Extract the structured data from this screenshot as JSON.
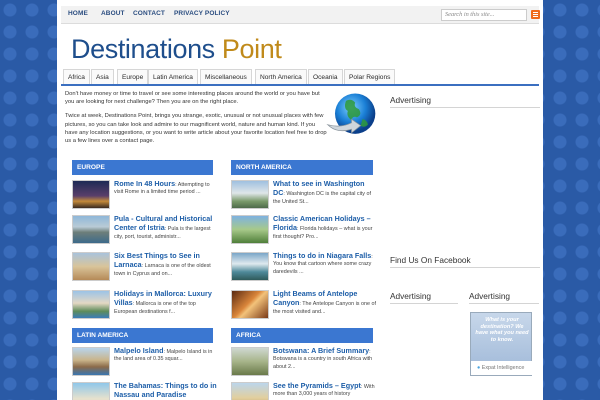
{
  "nav": {
    "home": "HOME",
    "about": "ABOUT",
    "contact": "CONTACT",
    "privacy": "PRIVACY POLICY",
    "search_placeholder": "Search in this site..."
  },
  "logo": {
    "part1": "Destinations ",
    "part2": "Point"
  },
  "categories": [
    "Africa",
    "Asia",
    "Europe",
    "Latin America",
    "Miscellaneous",
    "North America",
    "Oceania",
    "Polar Regions"
  ],
  "intro": {
    "p1": "Don't have money or time to travel or see some interesting places around the world or you have but you are looking for next challenge? Then you are on the right place.",
    "p2": "Twice at week, Destinations Point, brings you strange, exotic, unusual or not unusual places with few pictures, so you can take look and admire to our magnificent world, nature and human kind. If you have any location suggestions, or you want to write article about your favorite location feel free to drop us a few lines over a contact page."
  },
  "sidebar": {
    "advertising1": "Advertising",
    "facebook": "Find Us On Facebook",
    "advertising2": "Advertising",
    "advertising3": "Advertising",
    "ad_text": "What is your destination? We have what you need to know.",
    "ad_brand": "Expat Intelligence"
  },
  "sections": {
    "europe": {
      "title": "EUROPE",
      "posts": [
        {
          "title": "Rome In 48 Hours",
          "excerpt": ": Attempting to visit Rome in a limited time period ..."
        },
        {
          "title": "Pula - Cultural and Historical Center of Istria",
          "excerpt": ": Pula is the largest city, port, tourist, administr..."
        },
        {
          "title": "Six Best Things to See in Larnaca",
          "excerpt": ": Larnaca is one of the oldest town in Cyprus and on..."
        },
        {
          "title": "Holidays in Mallorca: Luxury Villas",
          "excerpt": ": Mallorca is one of the top European destinations f..."
        }
      ]
    },
    "north_america": {
      "title": "NORTH AMERICA",
      "posts": [
        {
          "title": "What to see in Washington DC",
          "excerpt": ": Washington DC is the capital city of the United St..."
        },
        {
          "title": "Classic American Holidays – Florida",
          "excerpt": ": Florida holidays – what is your first thought? Pro..."
        },
        {
          "title": "Things to do in Niagara Falls",
          "excerpt": ": You know that cartoon where some crazy daredevils ..."
        },
        {
          "title": "Light Beams of Antelope Canyon",
          "excerpt": ": The Antelope Canyon is one of the most visited and..."
        }
      ]
    },
    "latin_america": {
      "title": "LATIN AMERICA",
      "posts": [
        {
          "title": "Malpelo Island",
          "excerpt": ": Malpelo Island is in the land area of 0.35 squar..."
        },
        {
          "title": "The Bahamas: Things to do in Nassau and Paradise",
          "excerpt": ""
        }
      ]
    },
    "africa": {
      "title": "AFRICA",
      "posts": [
        {
          "title": "Botswana: A Brief Summary",
          "excerpt": ": Botswana is a country in south Africa with about 2..."
        },
        {
          "title": "See the Pyramids – Egypt",
          "excerpt": ": With more than 3,000 years of history"
        }
      ]
    }
  },
  "colors": {
    "accent": "#3b77d1",
    "link": "#1d5ea8",
    "logo_gold": "#c08a1a",
    "background": "#2a5aa6"
  }
}
